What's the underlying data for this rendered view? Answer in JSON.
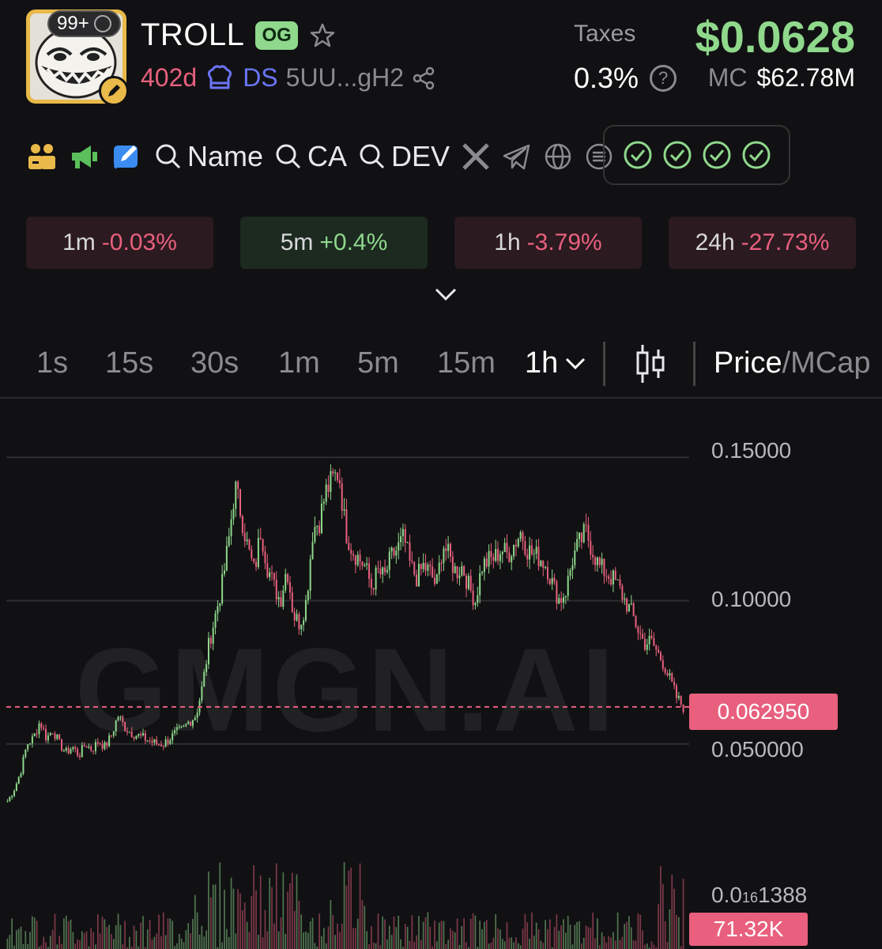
{
  "header": {
    "notif_count": "99+",
    "token_name": "TROLL",
    "og_label": "OG",
    "age": "402d",
    "platform": "DS",
    "address": "5UU...gH2",
    "taxes_label": "Taxes",
    "taxes_value": "0.3%",
    "price": "$0.0628",
    "mc_label": "MC",
    "mc_value": "$62.78M"
  },
  "tools": {
    "search_name": "Name",
    "search_ca": "CA",
    "search_dev": "DEV",
    "checks_count": 4
  },
  "changes": [
    {
      "period": "1m",
      "value": "-0.03%",
      "trend": "down"
    },
    {
      "period": "5m",
      "value": "+0.4%",
      "trend": "up"
    },
    {
      "period": "1h",
      "value": "-3.79%",
      "trend": "down"
    },
    {
      "period": "24h",
      "value": "-27.73%",
      "trend": "down"
    }
  ],
  "timeframes": {
    "items": [
      "1s",
      "15s",
      "30s",
      "1m",
      "5m",
      "15m"
    ],
    "selected": "1h",
    "price_label": "Price",
    "slash": "/",
    "mcap_label": "MCap"
  },
  "colors": {
    "up": "#8fd88c",
    "down": "#e8607e",
    "accent": "#e9b949"
  },
  "chart": {
    "watermark": "GMGN.AI",
    "y_labels": [
      "0.15000",
      "0.10000",
      "0.050000"
    ],
    "current_price_label": "0.062950",
    "volume_scale_main": "0.0",
    "volume_scale_sub": "16",
    "volume_scale_tail": "1388",
    "volume_label": "71.32K"
  },
  "chart_data": {
    "type": "candlestick",
    "interval": "1h",
    "ylim": [
      0.016,
      0.165
    ],
    "y_ticks": [
      0.15,
      0.1,
      0.05
    ],
    "current_price": 0.06295,
    "close_path": [
      0.03,
      0.034,
      0.04,
      0.05,
      0.052,
      0.058,
      0.052,
      0.055,
      0.05,
      0.047,
      0.049,
      0.046,
      0.05,
      0.048,
      0.051,
      0.049,
      0.053,
      0.06,
      0.056,
      0.054,
      0.053,
      0.052,
      0.051,
      0.05,
      0.05,
      0.052,
      0.054,
      0.055,
      0.058,
      0.06,
      0.07,
      0.085,
      0.095,
      0.105,
      0.12,
      0.14,
      0.13,
      0.118,
      0.11,
      0.125,
      0.112,
      0.105,
      0.1,
      0.112,
      0.095,
      0.092,
      0.1,
      0.125,
      0.128,
      0.138,
      0.142,
      0.145,
      0.125,
      0.118,
      0.115,
      0.112,
      0.105,
      0.11,
      0.108,
      0.115,
      0.118,
      0.122,
      0.112,
      0.108,
      0.112,
      0.11,
      0.105,
      0.12,
      0.115,
      0.11,
      0.112,
      0.105,
      0.1,
      0.112,
      0.114,
      0.115,
      0.118,
      0.116,
      0.12,
      0.124,
      0.118,
      0.116,
      0.115,
      0.112,
      0.105,
      0.1,
      0.104,
      0.115,
      0.12,
      0.124,
      0.118,
      0.112,
      0.11,
      0.108,
      0.105,
      0.1,
      0.096,
      0.09,
      0.085,
      0.086,
      0.082,
      0.078,
      0.072,
      0.066,
      0.063
    ]
  }
}
